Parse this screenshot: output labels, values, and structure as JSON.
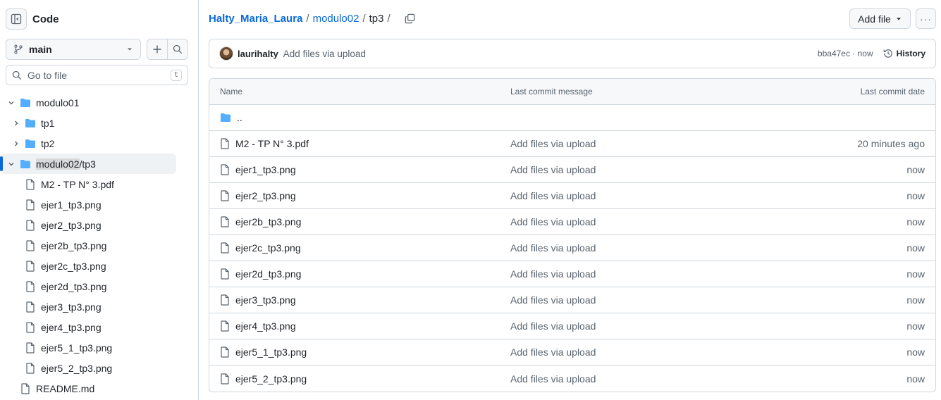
{
  "sidebar": {
    "title": "Code",
    "branch": "main",
    "goto_placeholder": "Go to file",
    "goto_shortcut": "t",
    "tree": [
      {
        "label": "modulo01",
        "type": "folder",
        "expanded": true,
        "level": 0
      },
      {
        "label": "tp1",
        "type": "folder",
        "expanded": false,
        "level": 1
      },
      {
        "label": "tp2",
        "type": "folder",
        "expanded": false,
        "level": 1
      },
      {
        "label_hl": "modulo02",
        "label_rest": "/tp3",
        "type": "folder",
        "expanded": true,
        "level": 0,
        "active": true
      },
      {
        "label": "M2 - TP N° 3.pdf",
        "type": "file",
        "level": 1
      },
      {
        "label": "ejer1_tp3.png",
        "type": "file",
        "level": 1
      },
      {
        "label": "ejer2_tp3.png",
        "type": "file",
        "level": 1
      },
      {
        "label": "ejer2b_tp3.png",
        "type": "file",
        "level": 1
      },
      {
        "label": "ejer2c_tp3.png",
        "type": "file",
        "level": 1
      },
      {
        "label": "ejer2d_tp3.png",
        "type": "file",
        "level": 1
      },
      {
        "label": "ejer3_tp3.png",
        "type": "file",
        "level": 1
      },
      {
        "label": "ejer4_tp3.png",
        "type": "file",
        "level": 1
      },
      {
        "label": "ejer5_1_tp3.png",
        "type": "file",
        "level": 1
      },
      {
        "label": "ejer5_2_tp3.png",
        "type": "file",
        "level": 1
      },
      {
        "label": "README.md",
        "type": "file",
        "level": 0
      }
    ]
  },
  "breadcrumb": {
    "repo": "Halty_Maria_Laura",
    "folder": "modulo02",
    "current": "tp3",
    "sep": "/"
  },
  "toolbar": {
    "add_file_label": "Add file",
    "more_label": "···"
  },
  "commit": {
    "author": "laurihalty",
    "message": "Add files via upload",
    "hash_time": "bba47ec · now",
    "history_label": "History"
  },
  "table": {
    "headers": {
      "name": "Name",
      "message": "Last commit message",
      "date": "Last commit date"
    },
    "parent_label": "..",
    "rows": [
      {
        "name": "M2 - TP N° 3.pdf",
        "message": "Add files via upload",
        "date": "20 minutes ago"
      },
      {
        "name": "ejer1_tp3.png",
        "message": "Add files via upload",
        "date": "now"
      },
      {
        "name": "ejer2_tp3.png",
        "message": "Add files via upload",
        "date": "now"
      },
      {
        "name": "ejer2b_tp3.png",
        "message": "Add files via upload",
        "date": "now"
      },
      {
        "name": "ejer2c_tp3.png",
        "message": "Add files via upload",
        "date": "now"
      },
      {
        "name": "ejer2d_tp3.png",
        "message": "Add files via upload",
        "date": "now"
      },
      {
        "name": "ejer3_tp3.png",
        "message": "Add files via upload",
        "date": "now"
      },
      {
        "name": "ejer4_tp3.png",
        "message": "Add files via upload",
        "date": "now"
      },
      {
        "name": "ejer5_1_tp3.png",
        "message": "Add files via upload",
        "date": "now"
      },
      {
        "name": "ejer5_2_tp3.png",
        "message": "Add files via upload",
        "date": "now"
      }
    ]
  },
  "colors": {
    "link": "#0969da",
    "folder": "#54aeff",
    "border": "#d0d7de",
    "muted": "#59636e"
  }
}
